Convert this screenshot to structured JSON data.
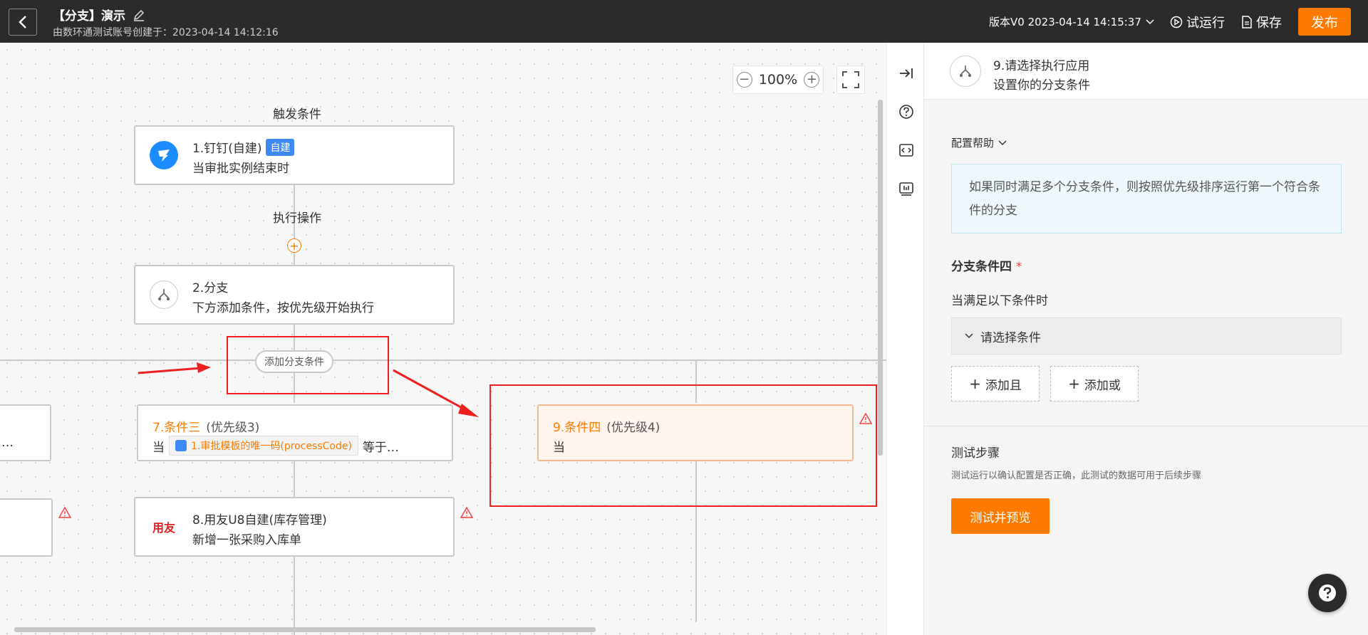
{
  "header": {
    "title": "【分支】演示",
    "subtitle": "由数环通测试账号创建于：2023-04-14 14:12:16",
    "version": "版本V0 2023-04-14 14:15:37",
    "test_run": "试运行",
    "save": "保存",
    "publish": "发布"
  },
  "canvas": {
    "zoom": "100%",
    "trigger_label": "触发条件",
    "action_label": "执行操作",
    "nodes": {
      "n1": {
        "title": "1.钉钉(自建)",
        "badge": "自建",
        "desc": "当审批实例结束时"
      },
      "n2": {
        "title": "2.分支",
        "desc": "下方添加条件，按优先级开始执行"
      },
      "n8": {
        "title": "8.用友U8自建(库存管理)",
        "desc": "新增一张采购入库单",
        "logo": "用友"
      }
    },
    "add_branch": "添加分支条件",
    "cond3": {
      "title": "7.条件三",
      "priority": "(优先级3)",
      "when": "当",
      "tag": "1.审批模板的唯一码(processCode)",
      "op": "等于…"
    },
    "cond4": {
      "title": "9.条件四",
      "priority": "(优先级4)",
      "when": "当"
    },
    "partial_left": "…"
  },
  "panel": {
    "header_title": "9.请选择执行应用",
    "header_sub": "设置你的分支条件",
    "help": "配置帮助",
    "notice": "如果同时满足多个分支条件，则按照优先级排序运行第一个符合条件的分支",
    "section": "分支条件四",
    "required": "*",
    "when_label": "当满足以下条件时",
    "select_placeholder": "请选择条件",
    "add_and": "添加且",
    "add_or": "添加或",
    "test_title": "测试步骤",
    "test_desc": "测试运行以确认配置是否正确，此测试的数据可用于后续步骤",
    "test_button": "测试并预览"
  },
  "colors": {
    "accent": "#ff7a00",
    "highlight": "#f02020",
    "badge": "#3d8af7"
  }
}
